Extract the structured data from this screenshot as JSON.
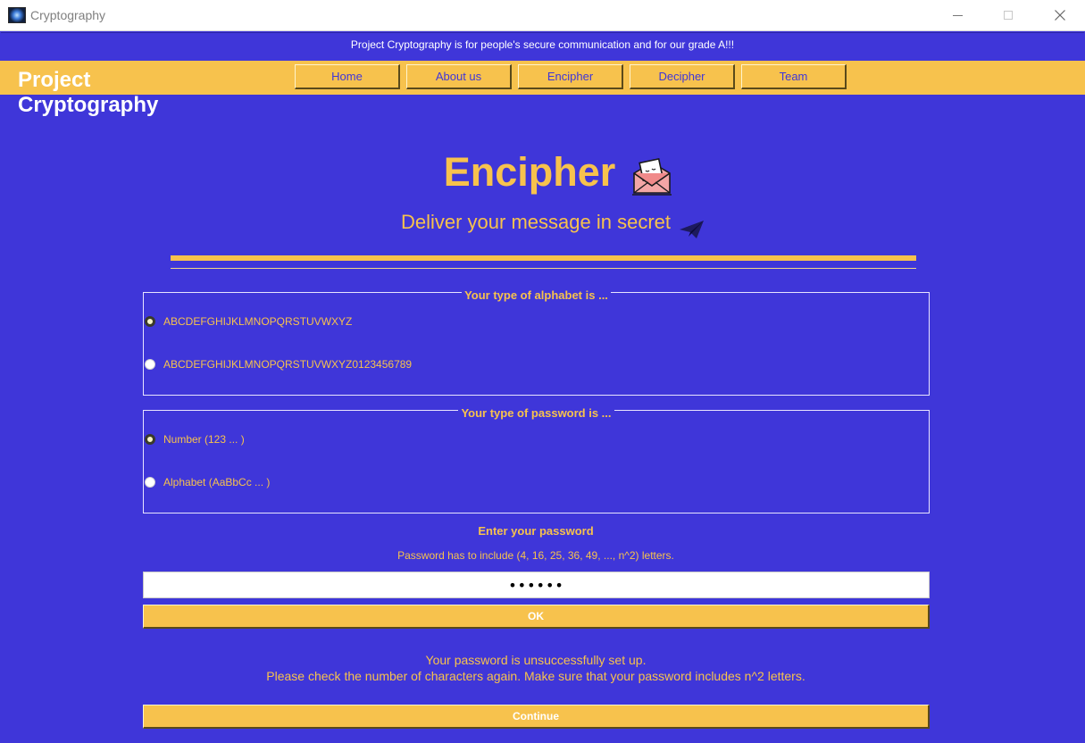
{
  "window": {
    "title": "Cryptography"
  },
  "banner": {
    "text": "Project Cryptography is for people's secure communication and for our grade A!!!"
  },
  "brand": {
    "line1": "Project",
    "line2": "Cryptography"
  },
  "nav": {
    "items": [
      {
        "label": "Home"
      },
      {
        "label": "About us"
      },
      {
        "label": "Encipher"
      },
      {
        "label": "Decipher"
      },
      {
        "label": "Team"
      }
    ]
  },
  "page": {
    "title": "Encipher",
    "subtitle": "Deliver your message in secret"
  },
  "alphabet_group": {
    "legend": "Your type of alphabet is ...",
    "options": [
      {
        "label": "ABCDEFGHIJKLMNOPQRSTUVWXYZ",
        "selected": true
      },
      {
        "label": "ABCDEFGHIJKLMNOPQRSTUVWXYZ0123456789",
        "selected": false
      }
    ]
  },
  "password_group": {
    "legend": "Your type of password is ...",
    "options": [
      {
        "label": "Number (123 ... )",
        "selected": true
      },
      {
        "label": "Alphabet (AaBbCc ... )",
        "selected": false
      }
    ]
  },
  "password": {
    "label": "Enter your password",
    "hint": "Password has to include (4, 16, 25, 36, 49, ..., n^2) letters.",
    "value": "abcdef",
    "ok_label": "OK"
  },
  "status": {
    "line1": "Your password is unsuccessfully set up.",
    "line2": "Please check the number of characters again. Make sure that your password includes n^2 letters."
  },
  "continue_label": "Continue",
  "colors": {
    "background": "#3f36d9",
    "accent": "#f7c24d",
    "banner_text": "#ffffff"
  }
}
